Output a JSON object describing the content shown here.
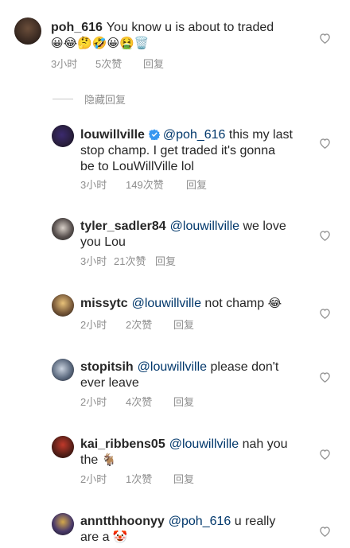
{
  "comments": [
    {
      "username": "poh_616",
      "text": "You know u is about to traded",
      "emojis": "😀😂🤔🤣😀🤮🗑️",
      "time": "3小时",
      "likes": "5次赞",
      "reply": "回复"
    },
    {
      "username": "louwillville",
      "mention": "@poh_616",
      "text_line1": "this my last",
      "text_line2": "stop champ. I get traded it's gonna",
      "text_line3": "be to LouWillVille lol",
      "time": "3小时",
      "likes": "149次赞",
      "reply": "回复"
    },
    {
      "username": "tyler_sadler84",
      "mention": "@louwillville",
      "text_line1": "we love",
      "text_line2": "you Lou",
      "time": "3小时",
      "likes": "21次赞",
      "reply": "回复"
    },
    {
      "username": "missytc",
      "mention": "@louwillville",
      "text_line1": "not champ",
      "emoji": "😂",
      "time": "2小时",
      "likes": "2次赞",
      "reply": "回复"
    },
    {
      "username": "stopitsih",
      "mention": "@louwillville",
      "text_line1": "please don't",
      "text_line2": "ever leave",
      "time": "2小时",
      "likes": "4次赞",
      "reply": "回复"
    },
    {
      "username": "kai_ribbens05",
      "mention": "@louwillville",
      "text_line1": "nah you",
      "text_line2": "the",
      "emoji": "🐐",
      "time": "2小时",
      "likes": "1次赞",
      "reply": "回复"
    },
    {
      "username": "anntthhoonyy",
      "mention": "@poh_616",
      "text_line1": "u really",
      "text_line2": "are a",
      "emoji": "🤡"
    }
  ],
  "hidden_replies": "隐藏回复",
  "icons": {
    "heart": "heart-outline-icon",
    "verified": "verified-badge-icon"
  },
  "colors": {
    "mention": "#00376b",
    "meta": "#8e8e8e",
    "verified": "#3897f0"
  }
}
